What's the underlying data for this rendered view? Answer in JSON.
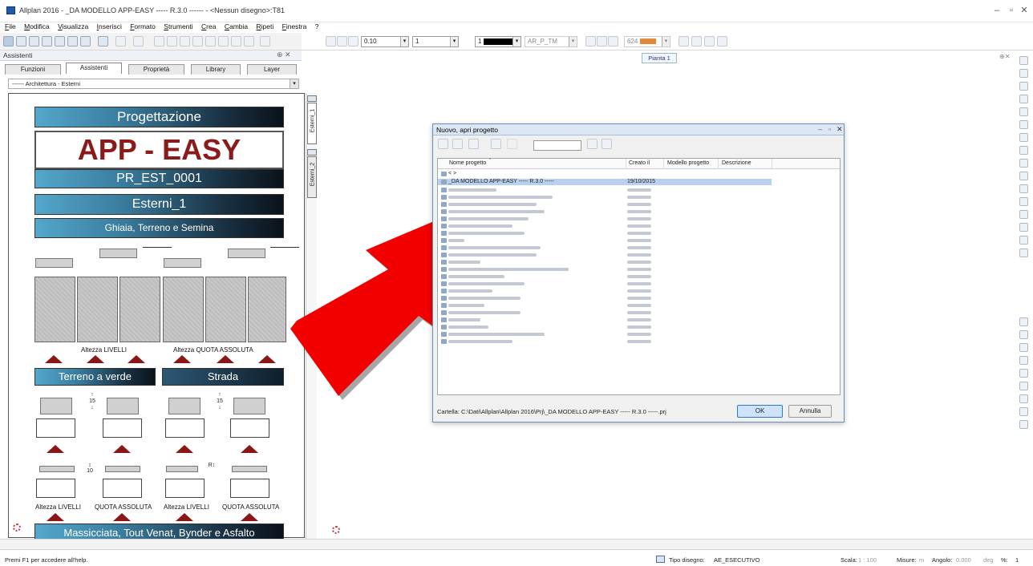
{
  "window": {
    "title": "Allplan 2016 - _DA MODELLO APP-EASY ----- R.3.0 ------ - <Nessun disegno>:T81",
    "controls": [
      "–",
      "▫",
      "✕"
    ]
  },
  "menu": [
    "File",
    "Modifica",
    "Visualizza",
    "Inserisci",
    "Formato",
    "Strumenti",
    "Crea",
    "Cambia",
    "Ripeti",
    "Finestra",
    "?"
  ],
  "toolbar2": {
    "pen": "0.10",
    "line": "1",
    "color": "1",
    "layer": "AR_P_TM",
    "scale": "624"
  },
  "panel": {
    "title": "Assistenti",
    "tabs": [
      "Funzioni",
      "Assistenti",
      "Proprietà",
      "Library",
      "Layer"
    ],
    "active_tab": "Assistenti",
    "combo_value": "------ Architettura - Esterni",
    "vtabs": [
      "Esterni_1",
      "Esterni_2"
    ]
  },
  "sheet": {
    "progettazione": "Progettazione",
    "app_easy": "APP - EASY",
    "code": "PR_EST_0001",
    "esterni": "Esterni_1",
    "ghiaia": "Ghiaia, Terreno e Semina",
    "altezza_livelli": "Altezza LIVELLI",
    "altezza_quota": "Altezza QUOTA ASSOLUTA",
    "terreno": "Terreno a verde",
    "strada": "Strada",
    "dim_a": "15",
    "dim_b": "15",
    "dim_c": "10",
    "dim_d": "R",
    "bottom_labels": [
      "Altezza LIVELLI",
      "QUOTA ASSOLUTA",
      "Altezza LIVELLI",
      "QUOTA ASSOLUTA"
    ],
    "massicciata": "Massicciata, Tout Venat, Bynder e Asfalto"
  },
  "drawing": {
    "tab": "Pianta 1"
  },
  "dialog": {
    "title": "Nuovo, apri progetto",
    "columns": [
      "Nome progetto",
      "Creato il",
      "Modello progetto",
      "Descrizione"
    ],
    "up_row": "<      >",
    "selected_name": "_DA MODELLO APP-EASY ----- R.3.0 -----",
    "selected_date": "19/10/2015",
    "path": "Cartella: C:\\Dati\\Allplan\\Allplan 2016\\Prj\\_DA MODELLO APP-EASY ----- R.3.0 -----.prj",
    "ok": "OK",
    "cancel": "Annulla"
  },
  "status": {
    "help": "Premi F1 per accedere all'help.",
    "tipo_label": "Tipo disegno:",
    "tipo_value": "AE_ESECUTIVO",
    "scala_label": "Scala:",
    "scala_value": "1 : 100",
    "misure_label": "Misure:",
    "misure_value": "m",
    "angolo_label": "Angolo:",
    "angolo_value": "0.000",
    "deg": "deg",
    "pct_label": "%:",
    "pct_value": "1"
  }
}
